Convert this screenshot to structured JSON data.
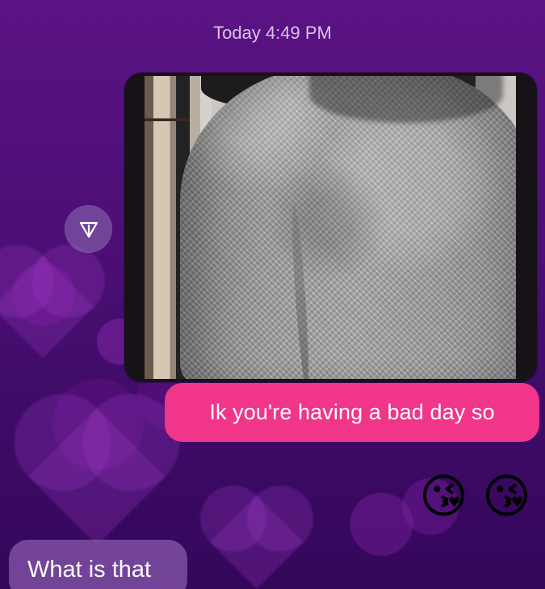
{
  "conversation": {
    "timestamp": "Today 4:49 PM",
    "messages": {
      "sent_text": "Ik you're having a bad day so",
      "emoji_1": "😘",
      "emoji_2": "😘",
      "received_text": "What is that"
    },
    "icons": {
      "share": "share-icon"
    }
  }
}
